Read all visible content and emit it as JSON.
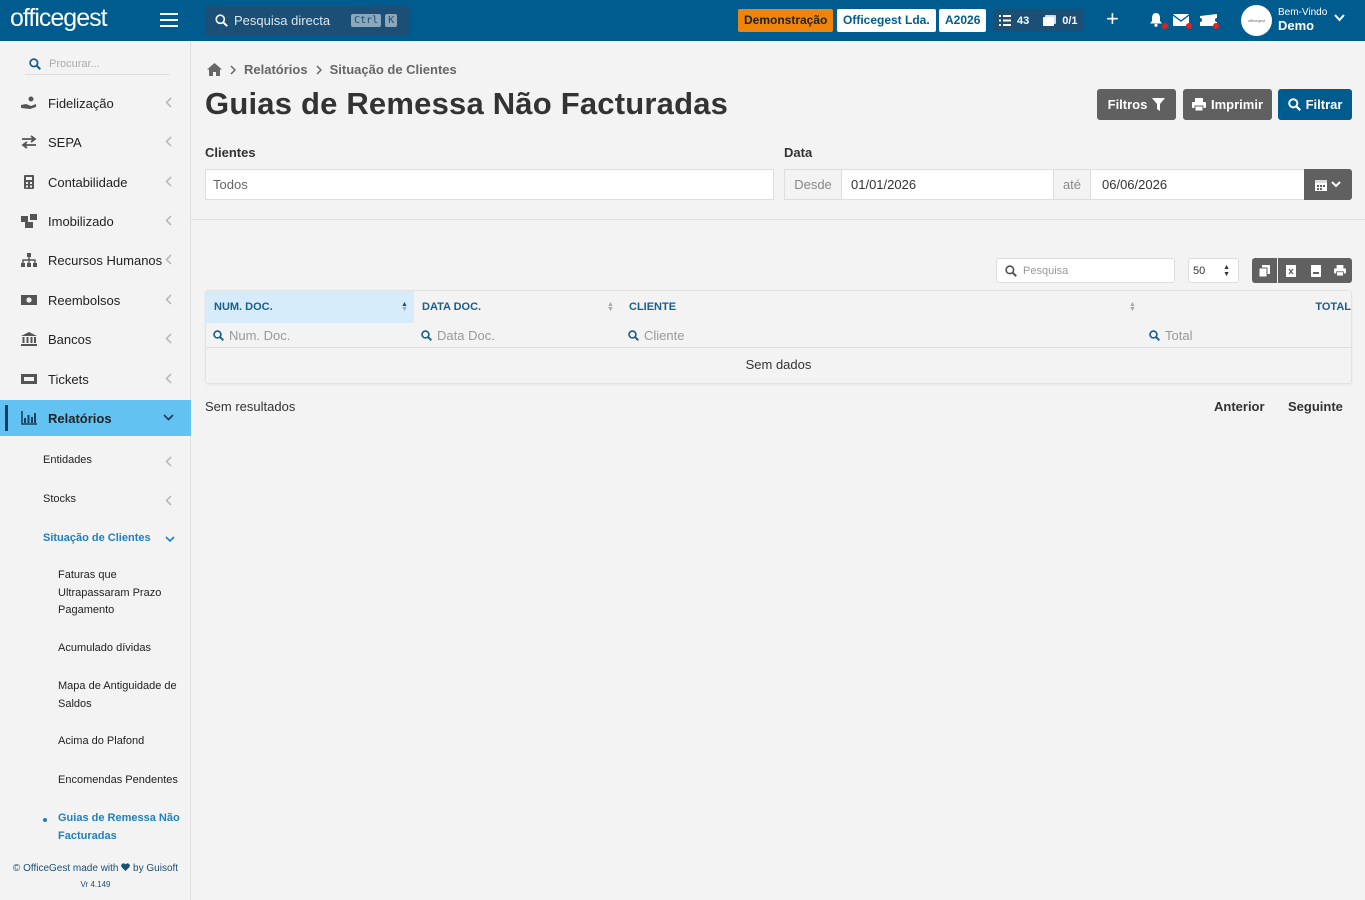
{
  "topbar": {
    "logo": "officegest",
    "search_placeholder": "Pesquisa directa",
    "kbd_ctrl": "Ctrl",
    "kbd_k": "K",
    "demo_label": "Demonstração",
    "company_label": "Officegest Lda.",
    "year_label": "A2026",
    "tasks_count": "43",
    "docs_count": "0/1",
    "welcome_small": "Bem-Vindo",
    "welcome_user": "Demo",
    "avatar_text": "officegest"
  },
  "sidebar": {
    "search_placeholder": "Procurar...",
    "items": [
      {
        "label": "Fidelização",
        "icon": "hand-coin-icon"
      },
      {
        "label": "SEPA",
        "icon": "arrows-exchange-icon"
      },
      {
        "label": "Contabilidade",
        "icon": "calculator-icon"
      },
      {
        "label": "Imobilizado",
        "icon": "boxes-icon"
      },
      {
        "label": "Recursos Humanos",
        "icon": "org-chart-icon"
      },
      {
        "label": "Reembolsos",
        "icon": "money-bill-icon"
      },
      {
        "label": "Bancos",
        "icon": "bank-icon"
      },
      {
        "label": "Tickets",
        "icon": "ticket-icon"
      },
      {
        "label": "Relatórios",
        "icon": "chart-icon"
      }
    ],
    "sub_items": [
      {
        "label": "Entidades"
      },
      {
        "label": "Stocks"
      },
      {
        "label": "Situação de Clientes"
      }
    ],
    "sub2_items": [
      {
        "label": "Faturas que Ultrapassaram Prazo Pagamento"
      },
      {
        "label": "Acumulado dívidas"
      },
      {
        "label": "Mapa de Antiguidade de Saldos"
      },
      {
        "label": "Acima do Plafond"
      },
      {
        "label": "Encomendas Pendentes"
      },
      {
        "label": "Guias de Remessa Não Facturadas"
      }
    ],
    "footer_pre": "© OfficeGest made with",
    "footer_post": "by Guisoft",
    "version": "Vr 4.149"
  },
  "breadcrumb": {
    "items": [
      "Relatórios",
      "Situação de Clientes"
    ]
  },
  "page": {
    "title": "Guias de Remessa Não Facturadas",
    "btn_filtros": "Filtros",
    "btn_imprimir": "Imprimir",
    "btn_filtrar": "Filtrar"
  },
  "form": {
    "clientes_label": "Clientes",
    "clientes_value": "Todos",
    "data_label": "Data",
    "desde_label": "Desde",
    "desde_value": "01/01/2026",
    "ate_label": "até",
    "ate_value": "06/06/2026"
  },
  "table": {
    "search_placeholder": "Pesquisa",
    "page_size": "50",
    "columns": [
      {
        "label": "NUM. DOC.",
        "filter": "Num. Doc."
      },
      {
        "label": "DATA DOC.",
        "filter": "Data Doc."
      },
      {
        "label": "CLIENTE",
        "filter": "Cliente"
      },
      {
        "label": "TOTAL",
        "filter": "Total"
      }
    ],
    "empty_text": "Sem dados",
    "results_text": "Sem resultados",
    "prev_label": "Anterior",
    "next_label": "Seguinte"
  },
  "colors": {
    "primary": "#005b8f",
    "accent_orange": "#f0830a",
    "active_nav": "#62c3f3",
    "button_gray": "#606060"
  }
}
